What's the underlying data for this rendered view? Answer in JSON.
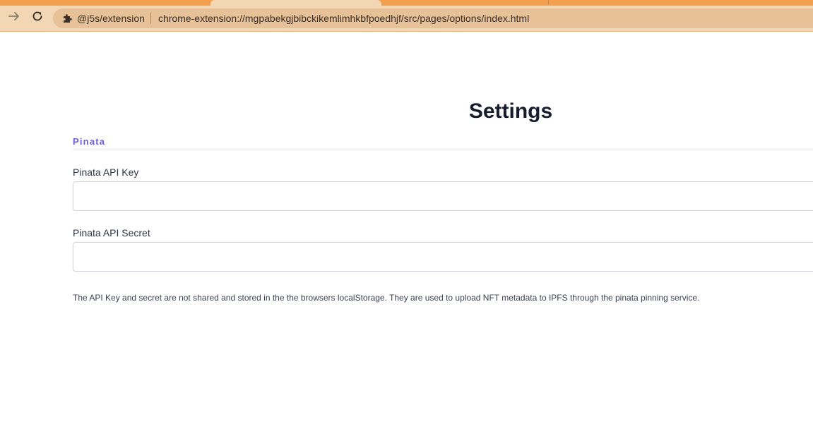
{
  "browser": {
    "source_label": "@j5s/extension",
    "url": "chrome-extension://mgpabekgjbibckikemlimhkbfpoedhjf/src/pages/options/index.html",
    "icons": {
      "forward": "arrow-right-icon",
      "reload": "reload-icon",
      "extension": "puzzle-piece-icon"
    },
    "colors": {
      "tabstrip": "#f2a04e",
      "toolbar": "#f3d7b4",
      "omnibox": "#e7c299"
    }
  },
  "page": {
    "title": "Settings",
    "section": {
      "label": "Pinata",
      "accent_color": "#6b5ed6"
    },
    "fields": {
      "api_key": {
        "label": "Pinata API Key",
        "value": ""
      },
      "api_secret": {
        "label": "Pinata API Secret",
        "value": ""
      }
    },
    "help_text": "The API Key and secret are not shared and stored in the the browsers localStorage. They are used to upload NFT metadata to IPFS through the pinata pinning service."
  }
}
